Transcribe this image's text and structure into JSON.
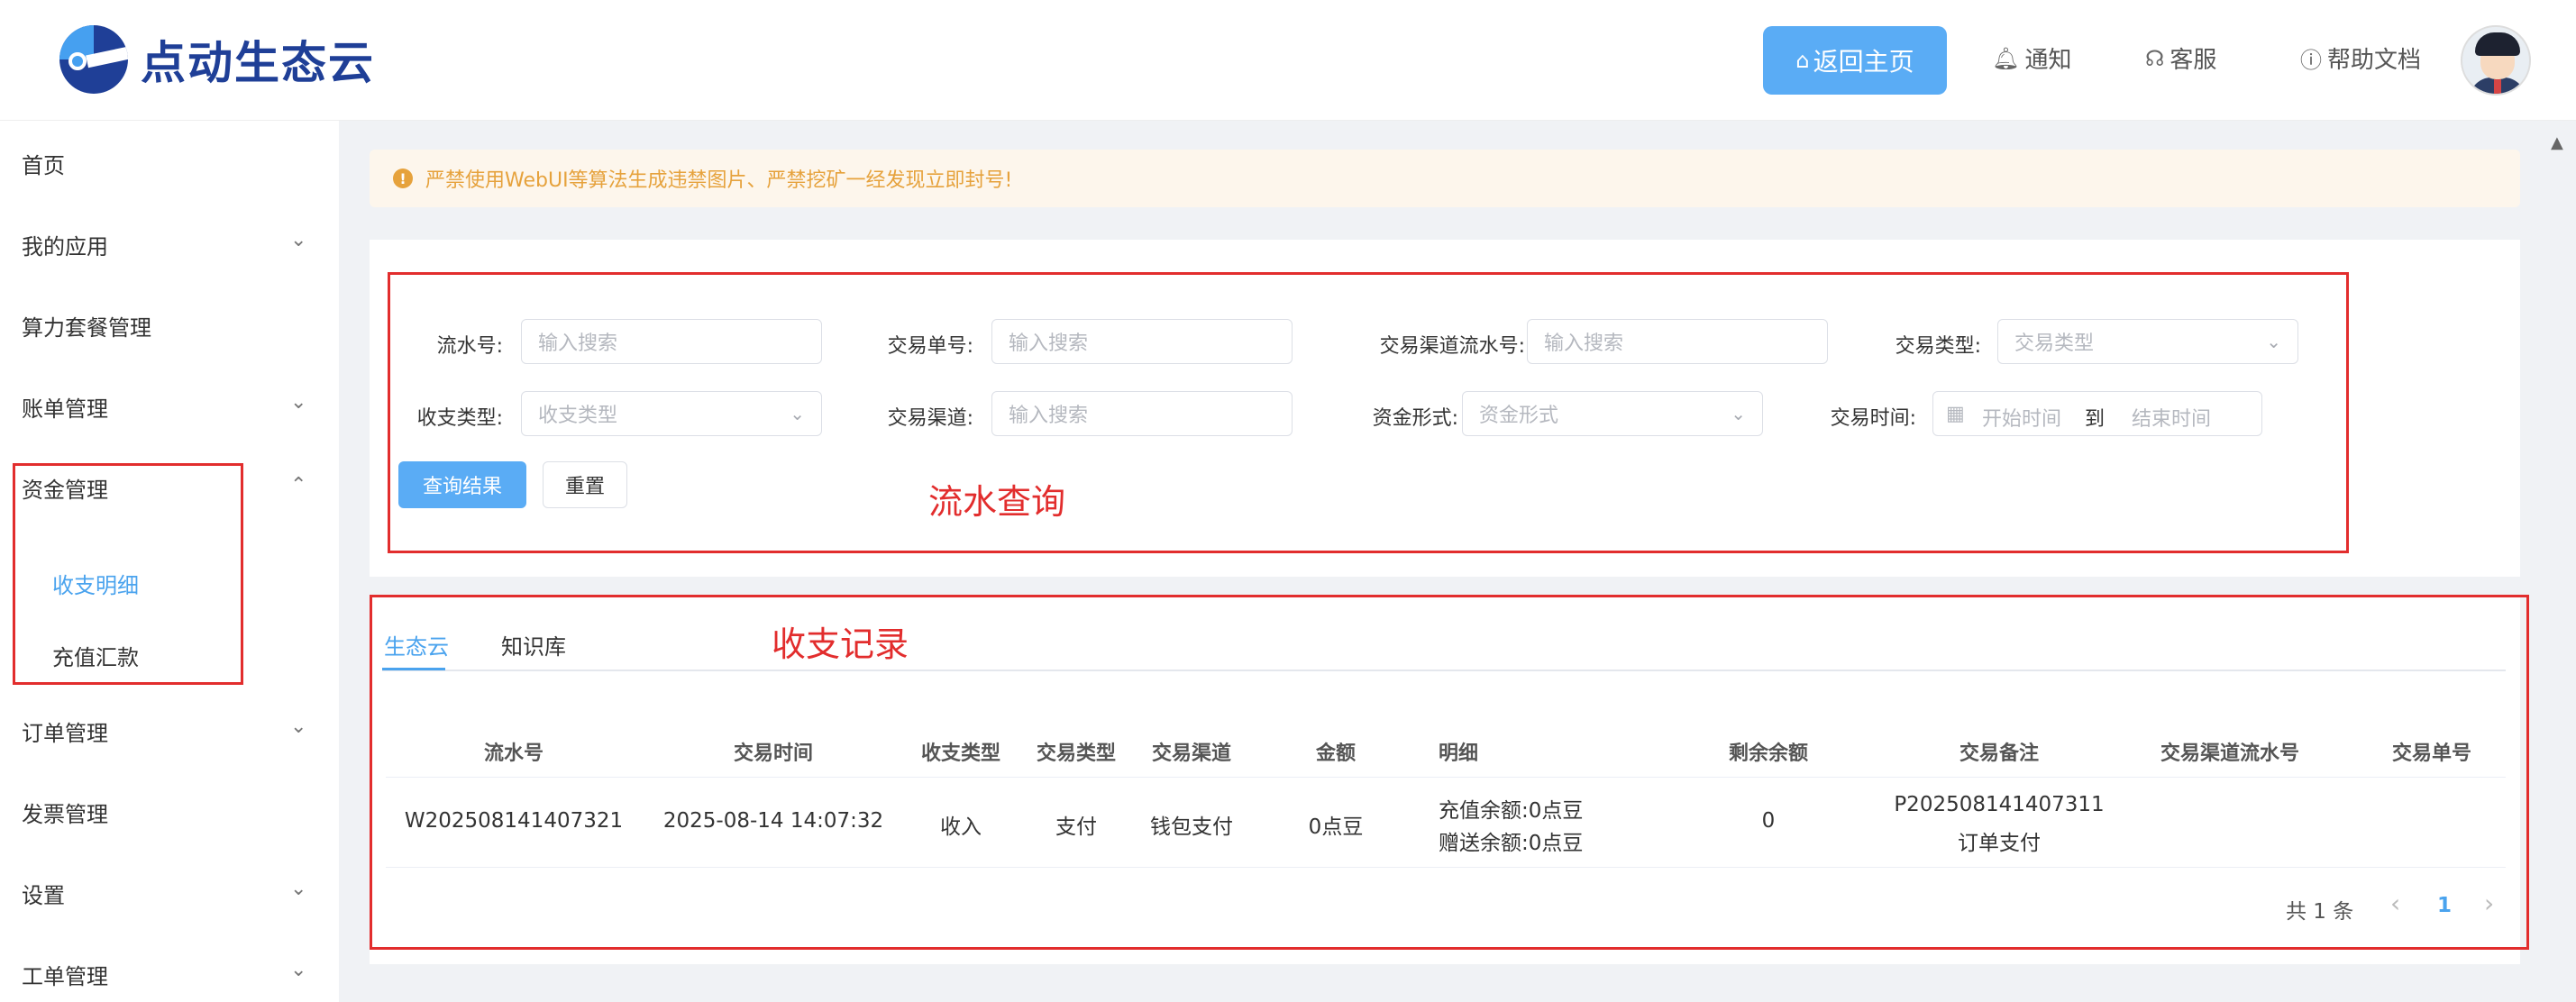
{
  "header": {
    "logo_text": "点动生态云",
    "home_label": "返回主页",
    "notify_label": "通知",
    "service_label": "客服",
    "help_label": "帮助文档"
  },
  "sidebar": {
    "items": [
      {
        "label": "首页",
        "has_arrow": false
      },
      {
        "label": "我的应用",
        "has_arrow": true
      },
      {
        "label": "算力套餐管理",
        "has_arrow": false
      },
      {
        "label": "账单管理",
        "has_arrow": true
      },
      {
        "label": "资金管理",
        "has_arrow": true,
        "expanded": true
      },
      {
        "label": "订单管理",
        "has_arrow": true
      },
      {
        "label": "发票管理",
        "has_arrow": false
      },
      {
        "label": "设置",
        "has_arrow": true
      },
      {
        "label": "工单管理",
        "has_arrow": true
      }
    ],
    "sub_items": [
      {
        "label": "收支明细",
        "active": true
      },
      {
        "label": "充值汇款",
        "active": false
      }
    ]
  },
  "notice": {
    "text": "严禁使用WebUI等算法生成违禁图片、严禁挖矿一经发现立即封号!"
  },
  "filters": {
    "serial_label": "流水号:",
    "serial_placeholder": "输入搜索",
    "order_label": "交易单号:",
    "order_placeholder": "输入搜索",
    "channel_serial_label": "交易渠道流水号:",
    "channel_serial_placeholder": "输入搜索",
    "trade_type_label": "交易类型:",
    "trade_type_placeholder": "交易类型",
    "inout_label": "收支类型:",
    "inout_placeholder": "收支类型",
    "channel_label": "交易渠道:",
    "channel_placeholder": "输入搜索",
    "fund_label": "资金形式:",
    "fund_placeholder": "资金形式",
    "time_label": "交易时间:",
    "time_start": "开始时间",
    "time_sep": "到",
    "time_end": "结束时间",
    "query_button": "查询结果",
    "reset_button": "重置",
    "annotation": "流水查询"
  },
  "records": {
    "annotation": "收支记录",
    "tabs": [
      "生态云",
      "知识库"
    ],
    "columns": [
      "流水号",
      "交易时间",
      "收支类型",
      "交易类型",
      "交易渠道",
      "金额",
      "明细",
      "剩余余额",
      "交易备注",
      "交易渠道流水号",
      "交易单号"
    ],
    "rows": [
      {
        "serial": "W202508141407321",
        "time": "2025-08-14 14:07:32",
        "inout": "收入",
        "trade_type": "支付",
        "channel": "钱包支付",
        "amount": "0点豆",
        "detail_1": "充值余额:0点豆",
        "detail_2": "赠送余额:0点豆",
        "balance": "0",
        "remark_1": "P202508141407311",
        "remark_2": "订单支付",
        "channel_serial": "",
        "order_no": ""
      }
    ],
    "pager": {
      "total": "共 1 条",
      "prev": "‹",
      "current": "1",
      "next": "›"
    }
  }
}
